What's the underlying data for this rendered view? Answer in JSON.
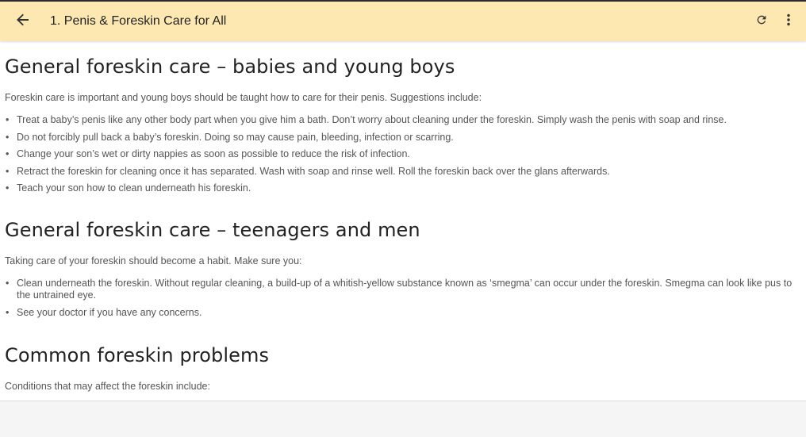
{
  "appbar": {
    "title": "1. Penis & Foreskin Care for All",
    "back_icon": "arrow-back-icon",
    "refresh_icon": "refresh-icon",
    "more_icon": "more-vert-icon",
    "background": "#fde8b2"
  },
  "sections": [
    {
      "heading": "General foreskin care – babies and young boys",
      "intro": "Foreskin care is important and young boys should be taught how to care for their penis. Suggestions include:",
      "items": [
        "Treat a baby’s penis like any other body part when you give him a bath. Don’t worry about cleaning under the foreskin. Simply wash the penis with soap and rinse.",
        "Do not forcibly pull back a baby’s foreskin. Doing so may cause pain, bleeding, infection or scarring.",
        "Change your son’s wet or dirty nappies as soon as possible to reduce the risk of infection.",
        "Retract the foreskin for cleaning once it has separated. Wash with soap and rinse well. Roll the foreskin back over the glans afterwards.",
        "Teach your son how to clean underneath his foreskin."
      ]
    },
    {
      "heading": "General foreskin care – teenagers and men",
      "intro": "Taking care of your foreskin should become a habit. Make sure you:",
      "items": [
        "Clean underneath the foreskin. Without regular cleaning, a build-up of a whitish-yellow substance known as ‘smegma’ can occur under the foreskin. Smegma can look like pus to the untrained eye.",
        "See your doctor if you have any concerns."
      ]
    },
    {
      "heading": "Common foreskin problems",
      "intro": "Conditions that may affect the foreskin include:"
    }
  ]
}
